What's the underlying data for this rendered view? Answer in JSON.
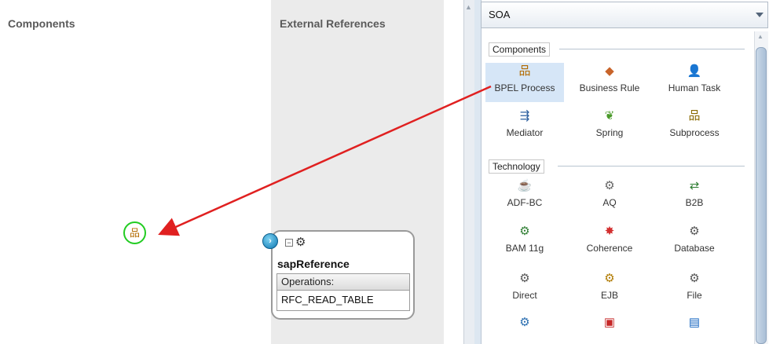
{
  "components_pane": {
    "title": "Components"
  },
  "external_references_pane": {
    "title": "External References"
  },
  "palette": {
    "selected_page": "SOA",
    "sections": [
      {
        "label": "Components",
        "items": [
          {
            "label": "BPEL Process",
            "icon": "bpel-process-icon",
            "glyph": "品",
            "color": "#b36b00",
            "selected": true
          },
          {
            "label": "Business Rule",
            "icon": "business-rule-icon",
            "glyph": "◆",
            "color": "#c8642a"
          },
          {
            "label": "Human Task",
            "icon": "human-task-icon",
            "glyph": "👤",
            "color": "#3a6ea5"
          },
          {
            "label": "Mediator",
            "icon": "mediator-icon",
            "glyph": "⇶",
            "color": "#2c5f9e"
          },
          {
            "label": "Spring",
            "icon": "spring-icon",
            "glyph": "❦",
            "color": "#4a9a2a"
          },
          {
            "label": "Subprocess",
            "icon": "subprocess-icon",
            "glyph": "品",
            "color": "#8a6a00"
          }
        ]
      },
      {
        "label": "Technology",
        "items": [
          {
            "label": "ADF-BC",
            "icon": "adf-bc-icon",
            "glyph": "☕",
            "color": "#8a6a3a"
          },
          {
            "label": "AQ",
            "icon": "aq-icon",
            "glyph": "⚙",
            "color": "#666666"
          },
          {
            "label": "B2B",
            "icon": "b2b-icon",
            "glyph": "⇄",
            "color": "#2e7d32"
          },
          {
            "label": "BAM 11g",
            "icon": "bam-11g-icon",
            "glyph": "⚙",
            "color": "#2e7d32"
          },
          {
            "label": "Coherence",
            "icon": "coherence-icon",
            "glyph": "✸",
            "color": "#d32f2f"
          },
          {
            "label": "Database",
            "icon": "database-icon",
            "glyph": "⚙",
            "color": "#555555"
          },
          {
            "label": "Direct",
            "icon": "direct-icon",
            "glyph": "⚙",
            "color": "#555555"
          },
          {
            "label": "EJB",
            "icon": "ejb-icon",
            "glyph": "⚙",
            "color": "#b07a00"
          },
          {
            "label": "File",
            "icon": "file-icon",
            "glyph": "⚙",
            "color": "#555555"
          },
          {
            "label": "",
            "icon": "ftp-icon",
            "glyph": "⚙",
            "color": "#2a6eb0"
          },
          {
            "label": "",
            "icon": "http-icon",
            "glyph": "▣",
            "color": "#c62828"
          },
          {
            "label": "",
            "icon": "jca-icon",
            "glyph": "▤",
            "color": "#1565c0"
          }
        ]
      }
    ]
  },
  "canvas": {
    "dropped_component": {
      "icon": "bpel-process-icon",
      "glyph": "品"
    },
    "sap_reference": {
      "name": "sapReference",
      "operations_header": "Operations:",
      "operations": [
        "RFC_READ_TABLE"
      ]
    }
  },
  "colors": {
    "drag_arrow": "#e02020",
    "drop_target_ring": "#22cc22",
    "selected_item": "#d6e6f7"
  }
}
